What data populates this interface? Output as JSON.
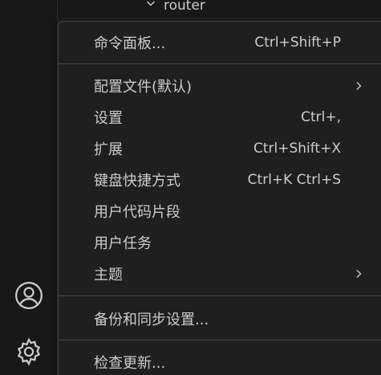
{
  "explorer": {
    "folder_name": "router"
  },
  "activity_bar": {
    "account_icon": "account-icon",
    "settings_icon": "gear-icon"
  },
  "menu": {
    "items": [
      {
        "label": "命令面板...",
        "shortcut": "Ctrl+Shift+P",
        "submenu": false
      },
      {
        "label": "配置文件(默认)",
        "shortcut": "",
        "submenu": true
      },
      {
        "label": "设置",
        "shortcut": "Ctrl+,",
        "submenu": false
      },
      {
        "label": "扩展",
        "shortcut": "Ctrl+Shift+X",
        "submenu": false
      },
      {
        "label": "键盘快捷方式",
        "shortcut": "Ctrl+K Ctrl+S",
        "submenu": false
      },
      {
        "label": "用户代码片段",
        "shortcut": "",
        "submenu": false
      },
      {
        "label": "用户任务",
        "shortcut": "",
        "submenu": false
      },
      {
        "label": "主题",
        "shortcut": "",
        "submenu": true
      },
      {
        "label": "备份和同步设置...",
        "shortcut": "",
        "submenu": false
      },
      {
        "label": "检查更新...",
        "shortcut": "",
        "submenu": false
      }
    ]
  },
  "colors": {
    "background": "#1f1f1f",
    "activity_bar": "#181818",
    "border": "#454545",
    "text": "#cccccc"
  }
}
